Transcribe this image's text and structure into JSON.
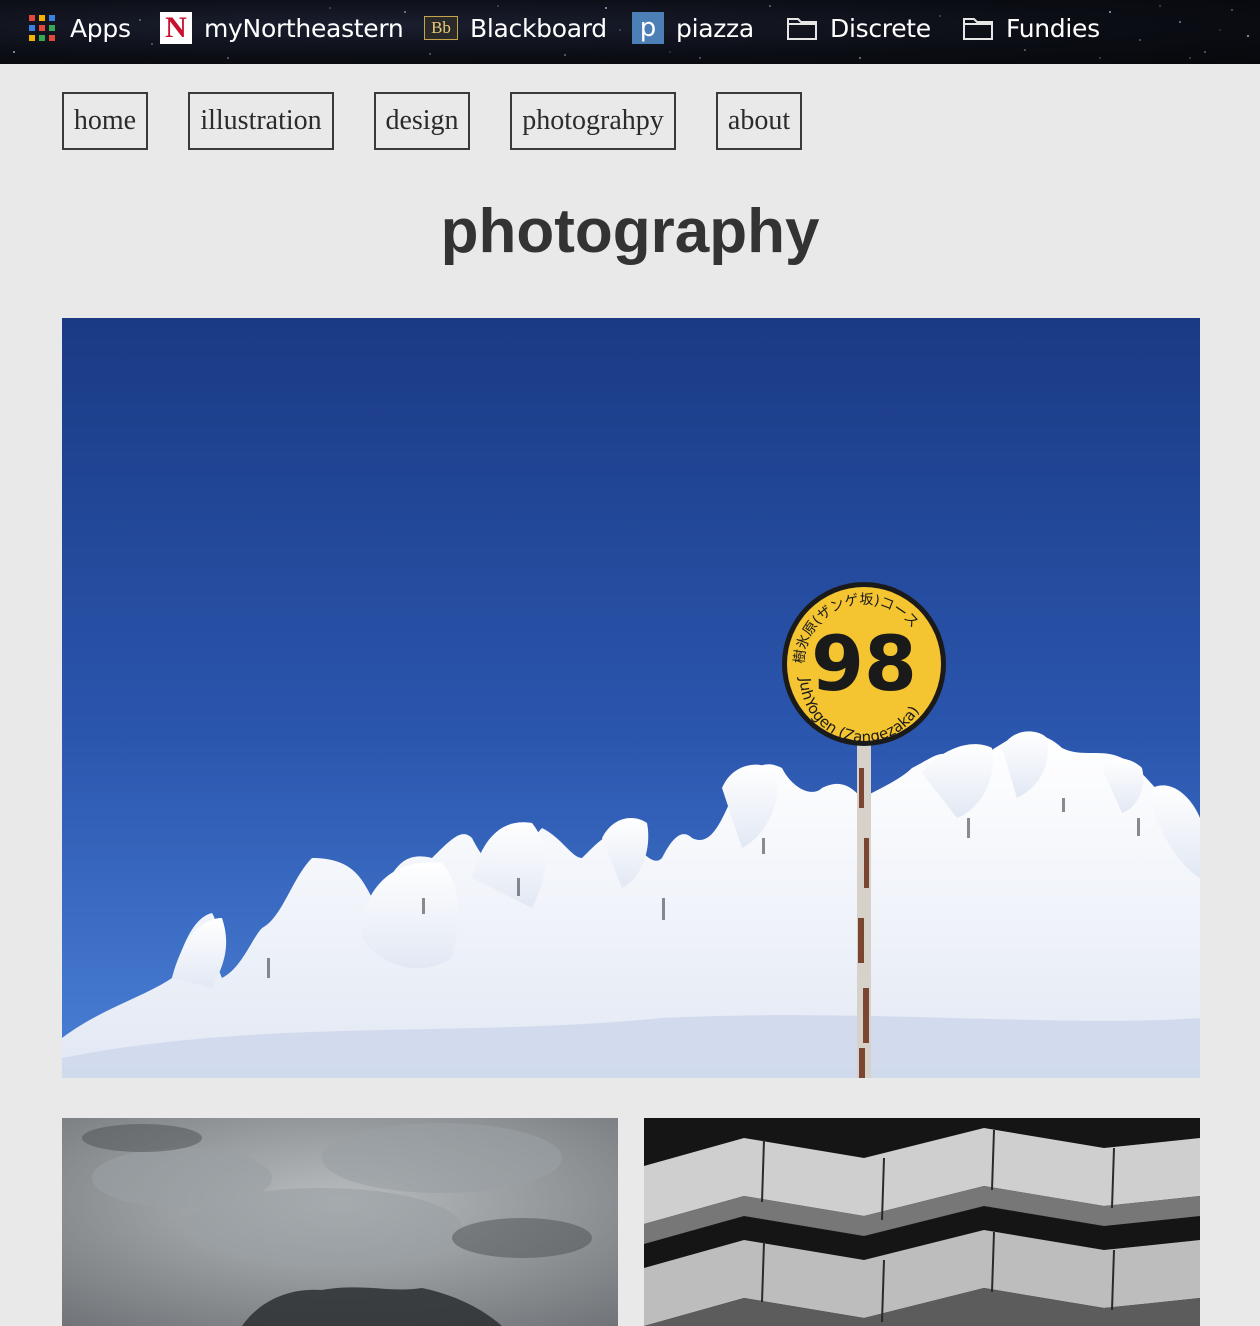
{
  "bookmarks": [
    {
      "label": "Apps",
      "icon": "apps-grid-icon"
    },
    {
      "label": "myNortheastern",
      "icon": "northeastern-n-icon",
      "icon_letter": "N"
    },
    {
      "label": "Blackboard",
      "icon": "blackboard-bb-icon",
      "icon_letter": "Bb"
    },
    {
      "label": "piazza",
      "icon": "piazza-p-icon",
      "icon_letter": "p"
    },
    {
      "label": "Discrete",
      "icon": "folder-icon"
    },
    {
      "label": "Fundies",
      "icon": "folder-icon"
    }
  ],
  "nav": [
    {
      "label": "home"
    },
    {
      "label": "illustration"
    },
    {
      "label": "design"
    },
    {
      "label": "photograhpy"
    },
    {
      "label": "about"
    }
  ],
  "page": {
    "title": "photography"
  },
  "photos": {
    "hero": {
      "subject": "snow-covered trees with sign",
      "sign_number": "98",
      "sign_top_text": "樹氷原(ザンゲ坂)コース",
      "sign_bottom_text": "JuhYogen (Zangezaka)"
    }
  },
  "colors": {
    "background": "#e9e9e9",
    "sky_top": "#1a3a84",
    "sky_bottom": "#3c70c8",
    "sign_yellow": "#f4c531",
    "text": "#333333"
  }
}
